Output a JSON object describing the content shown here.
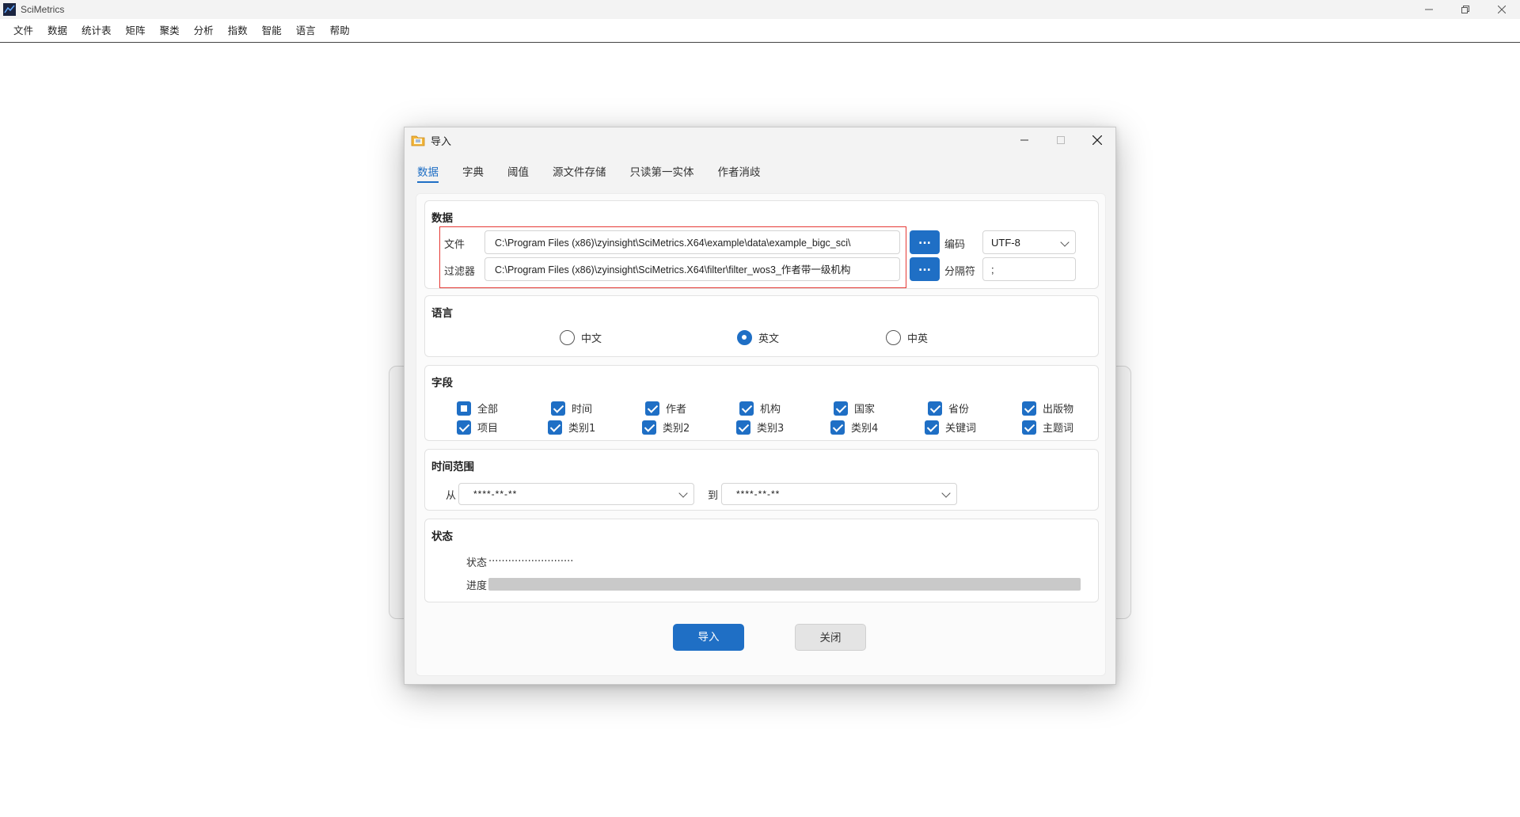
{
  "app": {
    "title": "SciMetrics"
  },
  "menu": [
    "文件",
    "数据",
    "统计表",
    "矩阵",
    "聚类",
    "分析",
    "指数",
    "智能",
    "语言",
    "帮助"
  ],
  "dialog": {
    "title": "导入",
    "tabs": [
      "数据",
      "字典",
      "阈值",
      "源文件存储",
      "只读第一实体",
      "作者消歧"
    ],
    "active_tab": "数据",
    "data_group": {
      "title": "数据",
      "file_label": "文件",
      "file_value": "C:\\Program Files (x86)\\zyinsight\\SciMetrics.X64\\example\\data\\example_bigc_sci\\",
      "filter_label": "过滤器",
      "filter_value": "C:\\Program Files (x86)\\zyinsight\\SciMetrics.X64\\filter\\filter_wos3_作者带一级机构",
      "browse_label": "...",
      "encoding_label": "编码",
      "encoding_value": "UTF-8",
      "separator_label": "分隔符",
      "separator_value": ";"
    },
    "language_group": {
      "title": "语言",
      "options": [
        "中文",
        "英文",
        "中英"
      ],
      "selected": "英文"
    },
    "fields_group": {
      "title": "字段",
      "row1": [
        "全部",
        "时间",
        "作者",
        "机构",
        "国家",
        "省份",
        "出版物"
      ],
      "row2": [
        "项目",
        "类别1",
        "类别2",
        "类别3",
        "类别4",
        "关键词",
        "主题词"
      ]
    },
    "time_group": {
      "title": "时间范围",
      "from_label": "从",
      "from_value": "****-**-**",
      "to_label": "到",
      "to_value": "****-**-**"
    },
    "status_group": {
      "title": "状态",
      "status_label": "状态",
      "status_value": "..........................",
      "progress_label": "进度",
      "progress": 0
    },
    "buttons": {
      "import": "导入",
      "close": "关闭"
    }
  },
  "colors": {
    "accent": "#1f6fc5",
    "highlight": "#e53935"
  }
}
